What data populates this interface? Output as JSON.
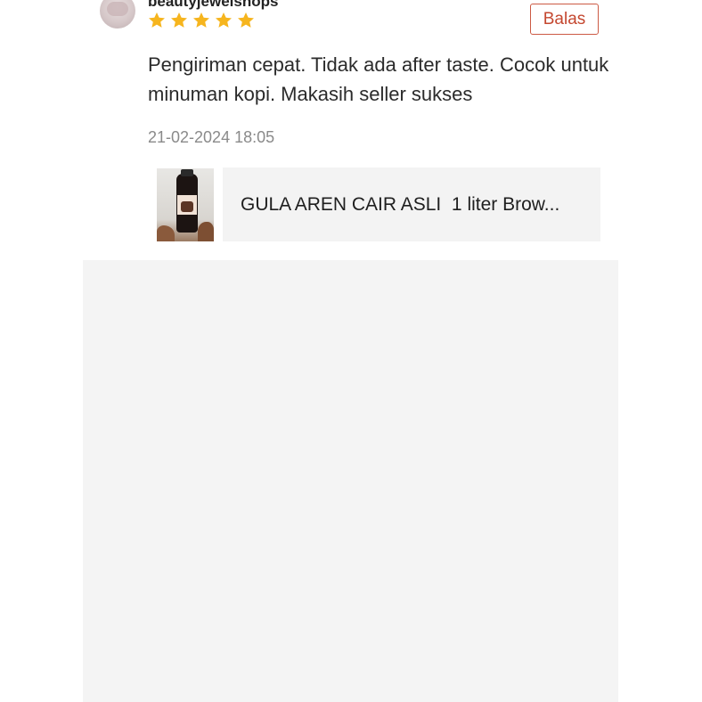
{
  "review": {
    "username": "beautyjewelshops",
    "rating": 5,
    "star_color": "#f6b51e",
    "reply_label": "Balas",
    "text": "Pengiriman cepat. Tidak ada after taste. Cocok untuk minuman kopi. Makasih seller sukses",
    "timestamp": "21-02-2024 18:05"
  },
  "product": {
    "title": "GULA AREN CAIR ASLI  1 liter Brow...",
    "thumbnail_icon": "syrup-bottle-icon"
  },
  "colors": {
    "accent": "#c4472f",
    "panel": "#f4f4f4",
    "card": "#f3f3f3"
  }
}
